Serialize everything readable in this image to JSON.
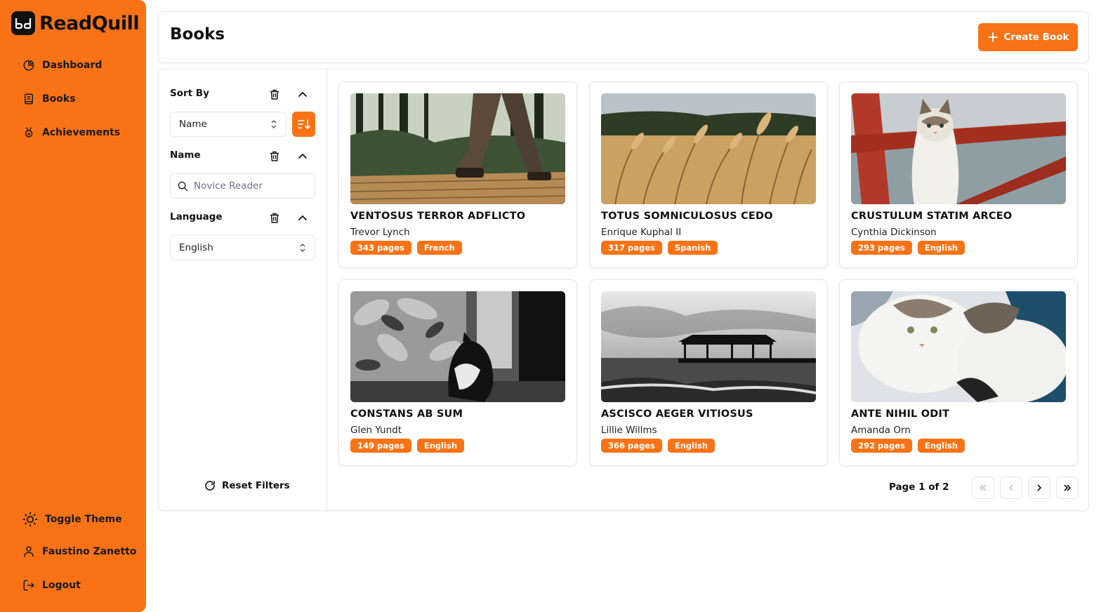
{
  "app": {
    "name": "ReadQuill"
  },
  "sidebar": {
    "nav": [
      {
        "label": "Dashboard",
        "icon": "chart-pie-icon"
      },
      {
        "label": "Books",
        "icon": "book-icon"
      },
      {
        "label": "Achievements",
        "icon": "award-icon"
      }
    ],
    "bottom": [
      {
        "label": "Toggle Theme",
        "icon": "sun-icon"
      },
      {
        "label": "Faustino Zanetto",
        "icon": "user-icon"
      },
      {
        "label": "Logout",
        "icon": "logout-icon"
      }
    ]
  },
  "header": {
    "title": "Books",
    "create_label": "Create Book"
  },
  "filters": {
    "sort_by": {
      "label": "Sort By",
      "value": "Name"
    },
    "name": {
      "label": "Name",
      "placeholder": "Novice Reader"
    },
    "language": {
      "label": "Language",
      "value": "English"
    },
    "reset_label": "Reset Filters"
  },
  "books": [
    {
      "title": "VENTOSUS TERROR ADFLICTO",
      "author": "Trevor Lynch",
      "pages": "343 pages",
      "language": "French",
      "image": "forest-boardwalk-photo"
    },
    {
      "title": "TOTUS SOMNICULOSUS CEDO",
      "author": "Enrique Kuphal II",
      "pages": "317 pages",
      "language": "Spanish",
      "image": "wheat-field-photo"
    },
    {
      "title": "CRUSTULUM STATIM ARCEO",
      "author": "Cynthia Dickinson",
      "pages": "293 pages",
      "language": "English",
      "image": "kitten-chair-photo"
    },
    {
      "title": "CONSTANS AB SUM",
      "author": "Glen Yundt",
      "pages": "149 pages",
      "language": "English",
      "image": "cat-curtain-photo"
    },
    {
      "title": "ASCISCO AEGER VITIOSUS",
      "author": "Lillie Willms",
      "pages": "366 pages",
      "language": "English",
      "image": "pier-sea-photo"
    },
    {
      "title": "ANTE NIHIL ODIT",
      "author": "Amanda Orn",
      "pages": "292 pages",
      "language": "English",
      "image": "cats-sleeping-photo"
    }
  ],
  "pagination": {
    "label": "Page 1 of 2"
  },
  "colors": {
    "accent": "#f97316",
    "border": "#e5e7eb"
  }
}
